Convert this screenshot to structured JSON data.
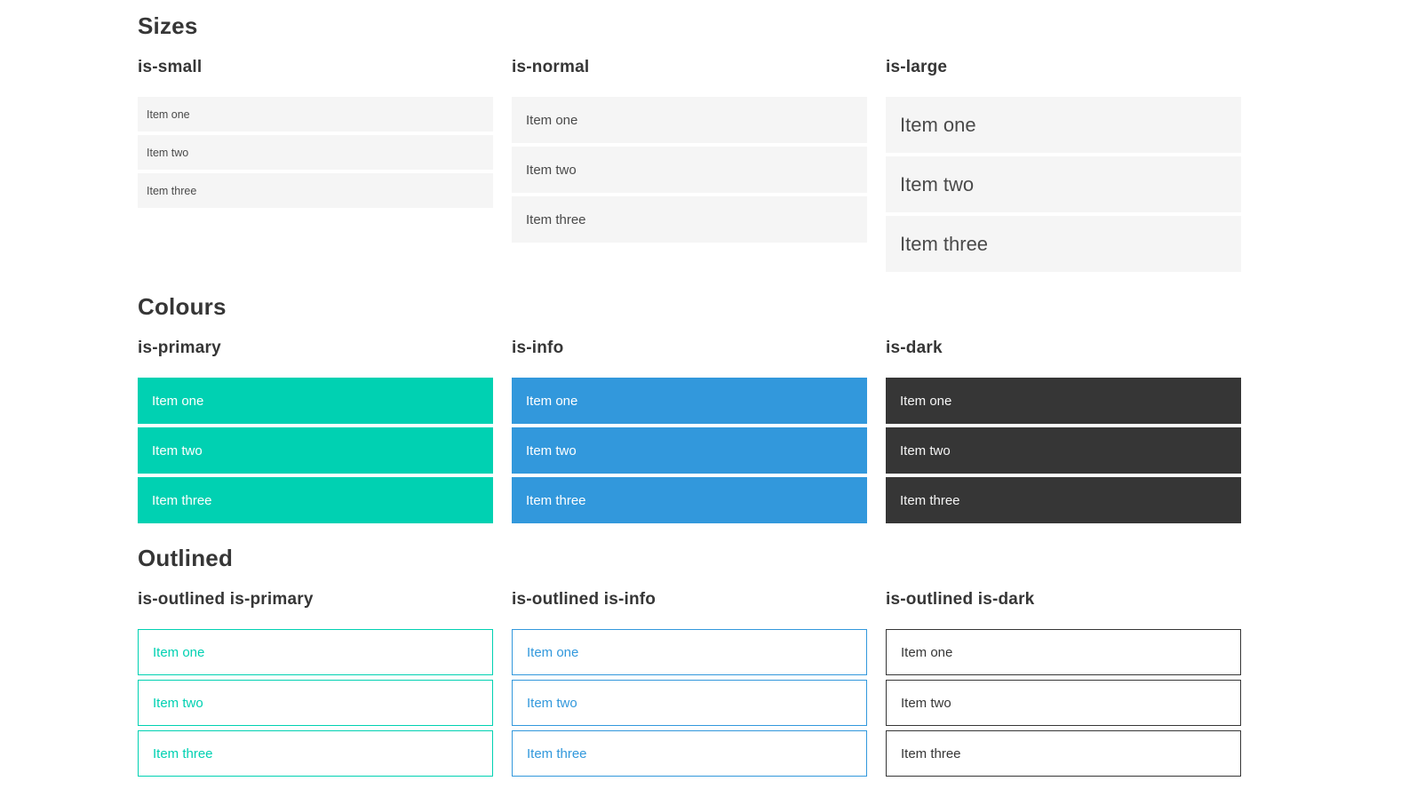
{
  "colors": {
    "primary": "#00d1b2",
    "info": "#3298dc",
    "dark": "#363636",
    "item_bg": "#f5f5f5",
    "item_text": "#4a4a4a",
    "heading": "#363636"
  },
  "sections": [
    {
      "title": "Sizes",
      "groups": [
        {
          "label": "is-small",
          "variant": "small",
          "items": [
            "Item one",
            "Item two",
            "Item three"
          ]
        },
        {
          "label": "is-normal",
          "variant": "normal",
          "items": [
            "Item one",
            "Item two",
            "Item three"
          ]
        },
        {
          "label": "is-large",
          "variant": "large",
          "items": [
            "Item one",
            "Item two",
            "Item three"
          ]
        }
      ]
    },
    {
      "title": "Colours",
      "groups": [
        {
          "label": "is-primary",
          "variant": "primary",
          "items": [
            "Item one",
            "Item two",
            "Item three"
          ]
        },
        {
          "label": "is-info",
          "variant": "info",
          "items": [
            "Item one",
            "Item two",
            "Item three"
          ]
        },
        {
          "label": "is-dark",
          "variant": "dark",
          "items": [
            "Item one",
            "Item two",
            "Item three"
          ]
        }
      ]
    },
    {
      "title": "Outlined",
      "groups": [
        {
          "label": "is-outlined is-primary",
          "variant": "outlined-primary",
          "items": [
            "Item one",
            "Item two",
            "Item three"
          ]
        },
        {
          "label": "is-outlined is-info",
          "variant": "outlined-info",
          "items": [
            "Item one",
            "Item two",
            "Item three"
          ]
        },
        {
          "label": "is-outlined is-dark",
          "variant": "outlined-dark",
          "items": [
            "Item one",
            "Item two",
            "Item three"
          ]
        }
      ]
    }
  ]
}
